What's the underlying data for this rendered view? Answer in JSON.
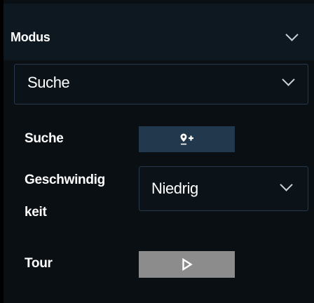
{
  "section": {
    "title": "Modus"
  },
  "mode_select": {
    "value": "Suche"
  },
  "rows": {
    "search_label": "Suche",
    "speed_label_line1": "Geschwindig",
    "speed_label_line2": "keit",
    "speed_value": "Niedrig",
    "tour_label": "Tour"
  },
  "icons": {
    "search_button": "add-location-pin-icon",
    "tour_button": "play-icon",
    "dropdown": "chevron-down-icon"
  },
  "colors": {
    "background": "#0a0f13",
    "header": "#0d1820",
    "search_button": "#22384c",
    "tour_button": "#8c8c8c",
    "text": "#ffffff"
  }
}
